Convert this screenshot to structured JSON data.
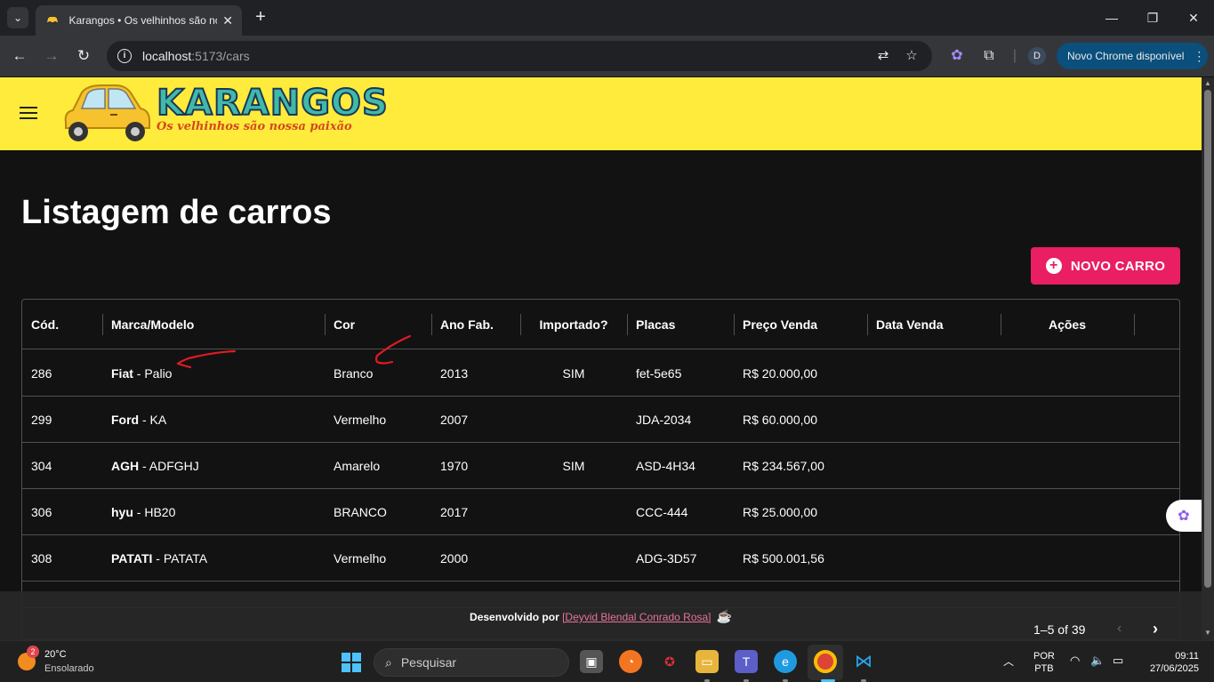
{
  "browser": {
    "tab_title": "Karangos • Os velhinhos são nossa paixão",
    "url_host": "localhost",
    "url_rest": ":5173/cars",
    "update_label": "Novo Chrome disponível",
    "profile_initial": "D"
  },
  "app": {
    "logo_text": "KARANGOS",
    "logo_slogan": "Os velhinhos são nossa paixão",
    "page_title": "Listagem de carros",
    "new_button_label": "NOVO CARRO"
  },
  "table": {
    "columns": [
      "Cód.",
      "Marca/Modelo",
      "Cor",
      "Ano Fab.",
      "Importado?",
      "Placas",
      "Preço Venda",
      "Data Venda",
      "Ações"
    ],
    "rows": [
      {
        "id": "286",
        "brand": "Fiat",
        "model": " - Palio",
        "color": "Branco",
        "year": "2013",
        "imported": "SIM",
        "plate": "fet-5e65",
        "price": "R$ 20.000,00",
        "sale_date": ""
      },
      {
        "id": "299",
        "brand": "Ford",
        "model": " - KA",
        "color": "Vermelho",
        "year": "2007",
        "imported": "",
        "plate": "JDA-2034",
        "price": "R$ 60.000,00",
        "sale_date": ""
      },
      {
        "id": "304",
        "brand": "AGH",
        "model": " - ADFGHJ",
        "color": "Amarelo",
        "year": "1970",
        "imported": "SIM",
        "plate": "ASD-4H34",
        "price": "R$ 234.567,00",
        "sale_date": ""
      },
      {
        "id": "306",
        "brand": "hyu",
        "model": " - HB20",
        "color": "BRANCO",
        "year": "2017",
        "imported": "",
        "plate": "CCC-444",
        "price": "R$ 25.000,00",
        "sale_date": ""
      },
      {
        "id": "308",
        "brand": "PATATI",
        "model": " - PATATA",
        "color": "Vermelho",
        "year": "2000",
        "imported": "",
        "plate": "ADG-3D57",
        "price": "R$ 500.001,56",
        "sale_date": ""
      }
    ],
    "pagination": "1–5 of 39"
  },
  "footer": {
    "prefix": "Desenvolvido por ",
    "author_link": "[Deyvid Blendal Conrado Rosa]"
  },
  "taskbar": {
    "weather_badge": "2",
    "weather_temp": "20°C",
    "weather_desc": "Ensolarado",
    "search_placeholder": "Pesquisar",
    "lang_line1": "POR",
    "lang_line2": "PTB",
    "time": "09:11",
    "date": "27/06/2025"
  },
  "colors": {
    "appbar": "#ffeb3b",
    "accent": "#e91e63",
    "background": "#121212",
    "annotation": "#e01b24"
  }
}
